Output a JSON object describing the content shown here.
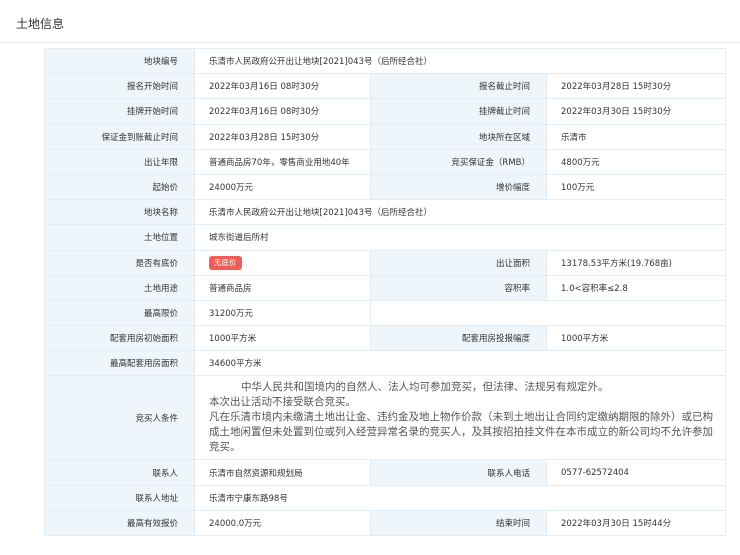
{
  "section_title": "土地信息",
  "rows": {
    "r1": {
      "l1": "地块编号",
      "v1": "乐清市人民政府公开出让地块[2021]043号（后所经合社）"
    },
    "r2": {
      "l1": "报名开始时间",
      "v1": "2022年03月16日 08时30分",
      "l2": "报名截止时间",
      "v2": "2022年03月28日 15时30分"
    },
    "r3": {
      "l1": "挂牌开始时间",
      "v1": "2022年03月16日 08时30分",
      "l2": "挂牌截止时间",
      "v2": "2022年03月30日 15时30分"
    },
    "r4": {
      "l1": "保证金到账截止时间",
      "v1": "2022年03月28日 15时30分",
      "l2": "地块所在区域",
      "v2": "乐清市"
    },
    "r5": {
      "l1": "出让年限",
      "v1": "普通商品房70年，零售商业用地40年",
      "l2": "竞买保证金（RMB）",
      "v2": "4800万元"
    },
    "r6": {
      "l1": "起始价",
      "v1": "24000万元",
      "l2": "增价幅度",
      "v2": "100万元"
    },
    "r7": {
      "l1": "地块名称",
      "v1": "乐清市人民政府公开出让地块[2021]043号（后所经合社）"
    },
    "r8": {
      "l1": "土地位置",
      "v1": "城东街道后所村"
    },
    "r9": {
      "l1": "是否有底价",
      "v1": "无底价",
      "l2": "出让面积",
      "v2": "13178.53平方米(19.768亩)"
    },
    "r10": {
      "l1": "土地用途",
      "v1": "普通商品房",
      "l2": "容积率",
      "v2": "1.0<容积率≤2.8"
    },
    "r11": {
      "l1": "最高限价",
      "v1": "31200万元"
    },
    "r12": {
      "l1": "配套用房初始面积",
      "v1": "1000平方米",
      "l2": "配套用房投报幅度",
      "v2": "1000平方米"
    },
    "r13": {
      "l1": "最高配套用房面积",
      "v1": "34600平方米"
    },
    "r14": {
      "l1": "竞买人条件",
      "p1": "中华人民共和国境内的自然人、法人均可参加竞买，但法律、法规另有规定外。",
      "p2": "本次出让活动不接受联合竞买。",
      "p3": "凡在乐清市境内未缴清土地出让金、违约金及地上物作价款（未到土地出让合同约定缴纳期限的除外）或已构成土地闲置但未处置到位或列入经营异常名录的竞买人，及其按招拍挂文件在本市成立的新公司均不允许参加竞买。"
    },
    "r15": {
      "l1": "联系人",
      "v1": "乐清市自然资源和规划局",
      "l2": "联系人电话",
      "v2": "0577-62572404"
    },
    "r16": {
      "l1": "联系人地址",
      "v1": "乐清市宁康东路98号"
    },
    "r17": {
      "l1": "最高有效报价",
      "v1": "24000.0万元",
      "l2": "结束时间",
      "v2": "2022年03月30日 15时44分"
    }
  }
}
